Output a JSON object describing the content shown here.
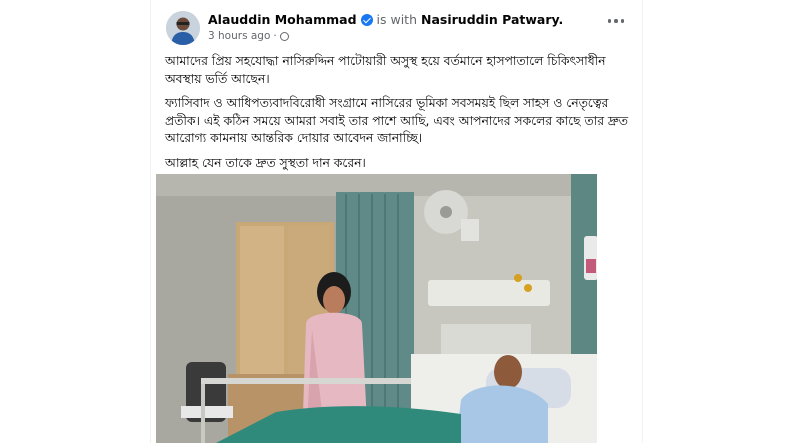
{
  "post": {
    "author": "Alauddin Mohammad",
    "with_text": "is with",
    "tagged": "Nasiruddin Patwary.",
    "time": "3 hours ago",
    "separator": "·",
    "paragraphs": [
      "আমাদের প্রিয় সহযোদ্ধা নাসিরুদ্দিন পাটোয়ারী অসুস্থ হয়ে বর্তমানে হাসপাতালে চিকিৎসাধীন অবস্থায় ভর্তি আছেন।",
      "ফ্যাসিবাদ ও আধিপত্যবাদবিরোধী সংগ্রামে নাসিরের ভূমিকা সবসময়ই ছিল সাহস ও নেতৃত্বের প্রতীক। এই কঠিন সময়ে আমরা সবাই তার পাশে আছি, এবং আপনাদের সকলের কাছে তার দ্রুত আরোগ্য কামনায় আন্তরিক দোয়ার আবেদন জানাচ্ছি।",
      "আল্লাহ যেন তাকে দ্রুত সুস্থতা দান করেন।"
    ]
  },
  "icons": {
    "verified": "verified-badge-icon",
    "privacy": "globe-icon",
    "more": "more-options-icon"
  },
  "colors": {
    "verified": "#1877f2",
    "primary_text": "#050505",
    "secondary_text": "#65676b"
  }
}
